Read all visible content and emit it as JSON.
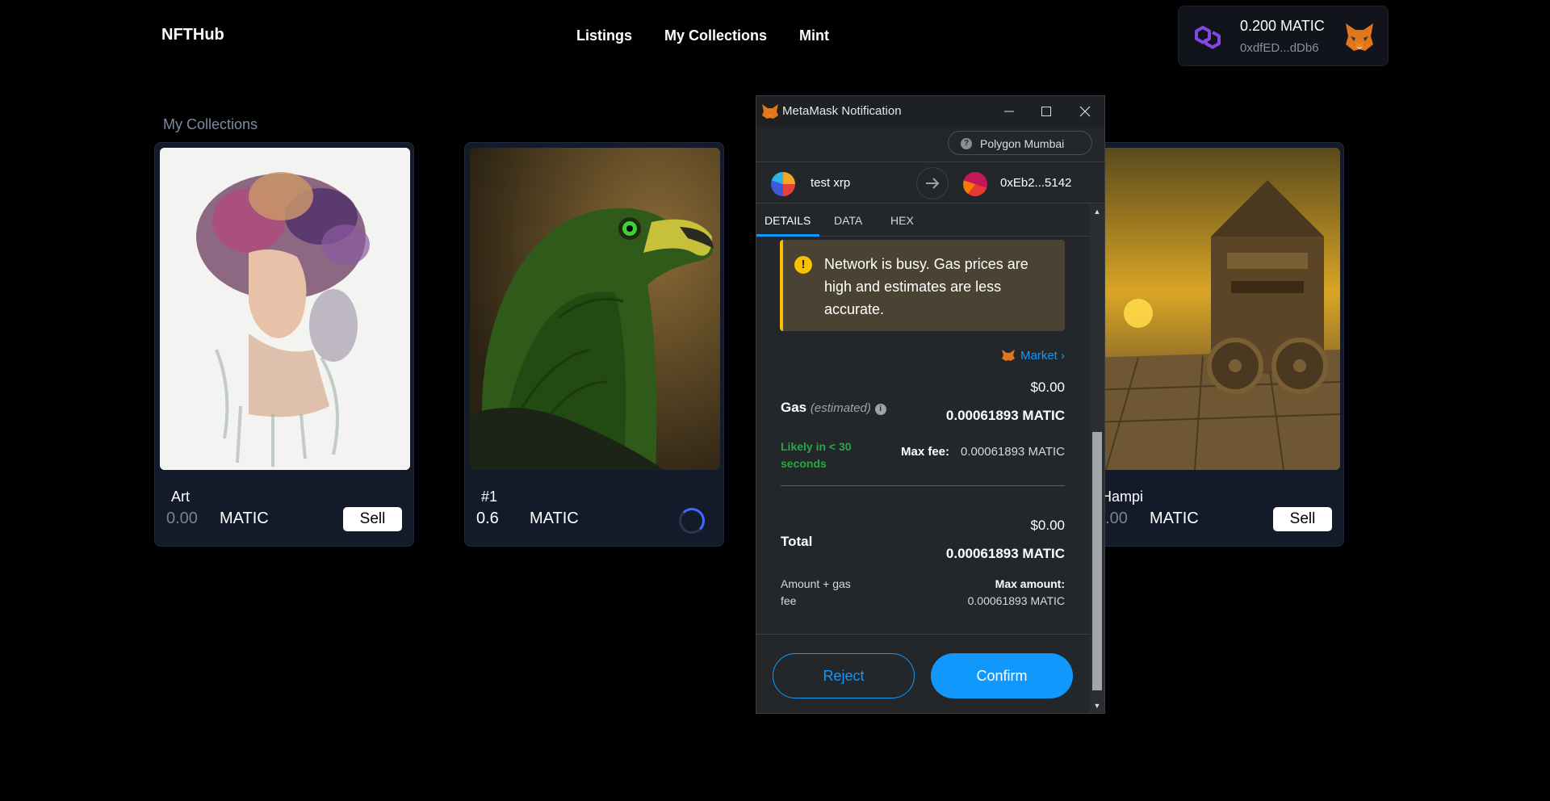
{
  "header": {
    "brand": "NFTHub",
    "nav": [
      "Listings",
      "My Collections",
      "Mint"
    ],
    "wallet": {
      "balance": "0.200 MATIC",
      "address": "0xdfED...dDb6"
    }
  },
  "section_title": "My Collections",
  "cards": [
    {
      "name": "Art",
      "price": "0.00",
      "currency": "MATIC",
      "action": "Sell"
    },
    {
      "name": "#1",
      "price": "0.6",
      "currency": "MATIC",
      "action": ""
    },
    {
      "name": "Hampi",
      "price": "0.00",
      "currency": "MATIC",
      "action": "Sell"
    }
  ],
  "metamask": {
    "window_title": "MetaMask Notification",
    "network": "Polygon Mumbai",
    "from_account": "test xrp",
    "to_account": "0xEb2...5142",
    "tabs": [
      "DETAILS",
      "DATA",
      "HEX"
    ],
    "warning": "Network is busy. Gas prices are high and estimates are less accurate.",
    "market_label": "Market",
    "gas": {
      "label": "Gas",
      "estimated": "(estimated)",
      "usd": "$0.00",
      "matic": "0.00061893 MATIC",
      "likely": "Likely in < 30 seconds",
      "max_fee_label": "Max fee:",
      "max_fee_value": "0.00061893 MATIC"
    },
    "total": {
      "label": "Total",
      "usd": "$0.00",
      "matic": "0.00061893 MATIC",
      "amount_gas_fee": "Amount + gas fee",
      "max_amount_label": "Max amount:",
      "max_amount_value": "0.00061893 MATIC"
    },
    "buttons": {
      "reject": "Reject",
      "confirm": "Confirm"
    }
  },
  "colors": {
    "accent": "#1098fc",
    "warning": "#f8c000",
    "success": "#28a745",
    "card_bg": "#131a29"
  }
}
